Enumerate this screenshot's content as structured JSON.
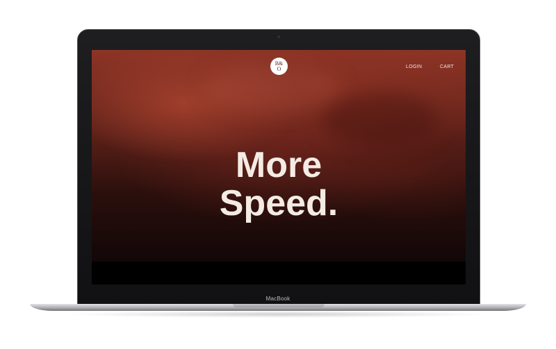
{
  "site": {
    "logo": {
      "line1": "B&",
      "line2": "O",
      "icon": "bo-logo-icon"
    },
    "nav": {
      "login": "LOGIN",
      "cart": "CART"
    },
    "hero": {
      "line1": "More",
      "line2": "Speed."
    }
  },
  "device": {
    "brand": "MacBook"
  },
  "colors": {
    "hero_red": "#8d3426",
    "hero_dark": "#120707",
    "headline": "#f4ece4"
  }
}
